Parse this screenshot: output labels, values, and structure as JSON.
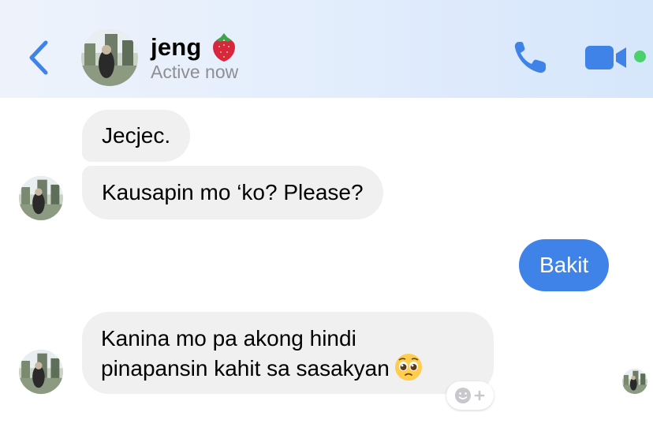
{
  "header": {
    "contact_name": "jeng",
    "status": "Active now",
    "colors": {
      "accent": "#3f83e9",
      "online": "#4cd06a"
    },
    "icons": [
      "back-chevron-icon",
      "strawberry-emoji-icon",
      "phone-icon",
      "video-camera-icon"
    ]
  },
  "messages": [
    {
      "from": "contact",
      "text": "Jecjec."
    },
    {
      "from": "contact",
      "text": "Kausapin mo ‘ko? Please?"
    },
    {
      "from": "me",
      "text": "Bakit"
    },
    {
      "from": "contact",
      "lines": [
        "Kanina mo pa akong hindi",
        "pinapansin kahit sa sasakyan"
      ],
      "emoji": "pleading-face"
    }
  ],
  "colors": {
    "incoming_bubble": "#f0f0f1",
    "outgoing_bubble": "#3f83e9"
  }
}
